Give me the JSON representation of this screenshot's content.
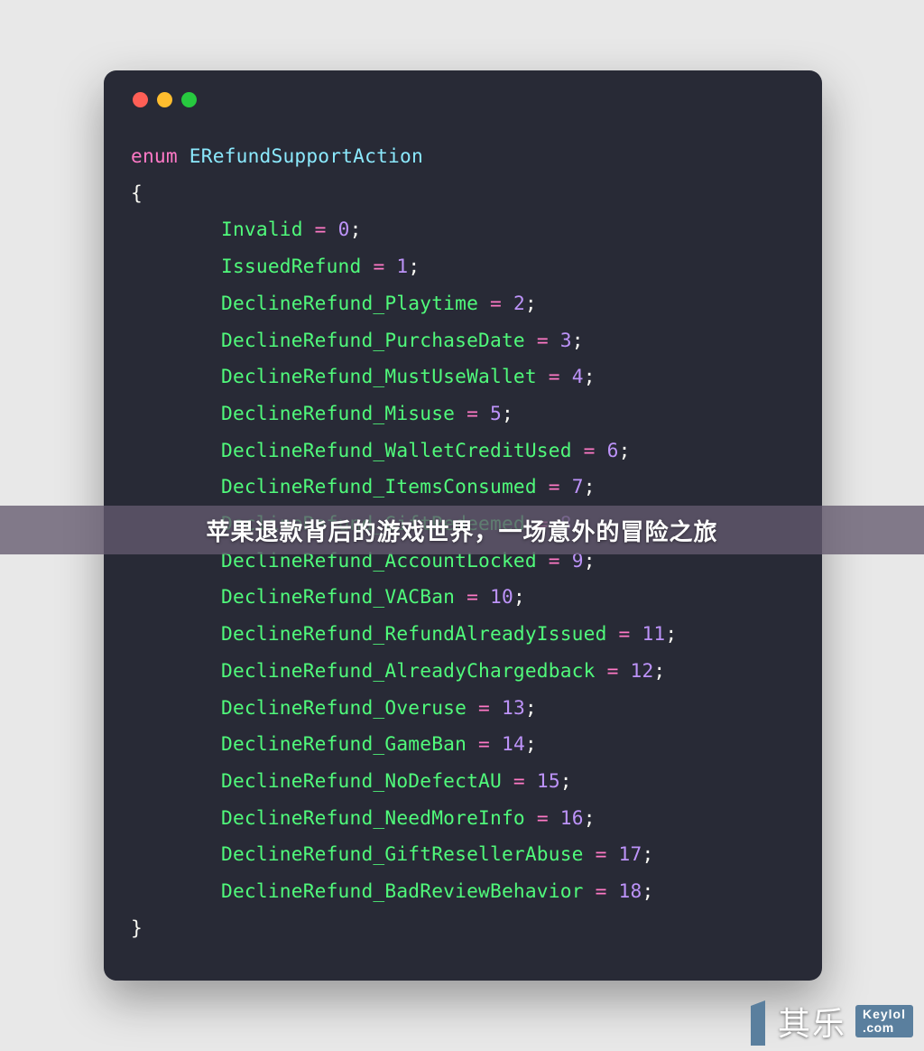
{
  "code": {
    "keyword": "enum",
    "typename": "ERefundSupportAction",
    "open_brace": "{",
    "close_brace": "}",
    "entries": [
      {
        "name": "Invalid",
        "value": "0"
      },
      {
        "name": "IssuedRefund",
        "value": "1"
      },
      {
        "name": "DeclineRefund_Playtime",
        "value": "2"
      },
      {
        "name": "DeclineRefund_PurchaseDate",
        "value": "3"
      },
      {
        "name": "DeclineRefund_MustUseWallet",
        "value": "4"
      },
      {
        "name": "DeclineRefund_Misuse",
        "value": "5"
      },
      {
        "name": "DeclineRefund_WalletCreditUsed",
        "value": "6"
      },
      {
        "name": "DeclineRefund_ItemsConsumed",
        "value": "7"
      },
      {
        "name": "DeclineRefund_GiftRedeemed",
        "value": "8"
      },
      {
        "name": "DeclineRefund_AccountLocked",
        "value": "9"
      },
      {
        "name": "DeclineRefund_VACBan",
        "value": "10"
      },
      {
        "name": "DeclineRefund_RefundAlreadyIssued",
        "value": "11"
      },
      {
        "name": "DeclineRefund_AlreadyChargedback",
        "value": "12"
      },
      {
        "name": "DeclineRefund_Overuse",
        "value": "13"
      },
      {
        "name": "DeclineRefund_GameBan",
        "value": "14"
      },
      {
        "name": "DeclineRefund_NoDefectAU",
        "value": "15"
      },
      {
        "name": "DeclineRefund_NeedMoreInfo",
        "value": "16"
      },
      {
        "name": "DeclineRefund_GiftResellerAbuse",
        "value": "17"
      },
      {
        "name": "DeclineRefund_BadReviewBehavior",
        "value": "18"
      }
    ]
  },
  "overlay": {
    "title": "苹果退款背后的游戏世界，一场意外的冒险之旅"
  },
  "watermark": {
    "chinese": "其乐",
    "line1": "Keylol",
    "line2": ".com"
  },
  "colors": {
    "window_bg": "#282a36",
    "keyword": "#ff79c6",
    "typename": "#8be9fd",
    "identifier": "#50fa7b",
    "number": "#bd93f9",
    "text": "#f8f8f2",
    "traffic_red": "#ff5f56",
    "traffic_yellow": "#ffbd2e",
    "traffic_green": "#27c93f",
    "overlay_bg": "rgba(100,90,110,0.78)",
    "watermark_box": "#5a7f9e"
  }
}
